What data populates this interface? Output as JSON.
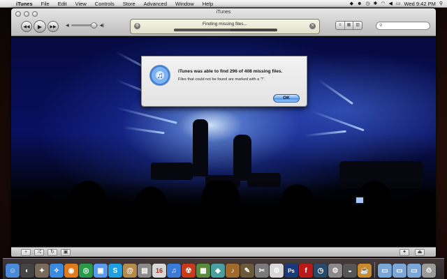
{
  "menubar": {
    "app_name": "iTunes",
    "items": [
      "File",
      "Edit",
      "View",
      "Controls",
      "Store",
      "Advanced",
      "Window",
      "Help"
    ],
    "clock": "Wed 9:42 PM"
  },
  "window": {
    "title": "iTunes",
    "lcd_status": "Finding missing files...",
    "progress_fraction": 0.55,
    "search_placeholder": ""
  },
  "dialog": {
    "title": "iTunes was able to find 296 of 408 missing files.",
    "message": "Files that could not be found are marked with a \"!\".",
    "ok_label": "OK"
  },
  "calendar": {
    "day": "16"
  },
  "accent_colors": {
    "ok_button": "#4c92e6",
    "lcd": "#e8ead4"
  },
  "dock": {
    "icons": [
      {
        "name": "finder-icon",
        "color": "#4a8ad8",
        "glyph": "☺"
      },
      {
        "name": "dashboard-icon",
        "color": "#444",
        "glyph": "◐"
      },
      {
        "name": "system-utility-icon",
        "color": "#7a6a5a",
        "glyph": "✦"
      },
      {
        "name": "safari-icon",
        "color": "#3a8ae0",
        "glyph": "✧"
      },
      {
        "name": "firefox-icon",
        "color": "#e07a1a",
        "glyph": "◉"
      },
      {
        "name": "chrome-icon",
        "color": "#2a9a4a",
        "glyph": "◎"
      },
      {
        "name": "facetime-icon",
        "color": "#5a9aee",
        "glyph": "▣"
      },
      {
        "name": "skype-icon",
        "color": "#1ea0e0",
        "glyph": "S"
      },
      {
        "name": "address-book-icon",
        "color": "#b58a4a",
        "glyph": "@"
      },
      {
        "name": "preview-icon",
        "color": "#8a8a8a",
        "glyph": "▤"
      },
      {
        "name": "calendar-icon",
        "color": "#d8d8d8",
        "glyph": "16"
      },
      {
        "name": "itunes-icon",
        "color": "#3a7ad8",
        "glyph": "♫"
      },
      {
        "name": "burn-icon",
        "color": "#c83a1a",
        "glyph": "☢"
      },
      {
        "name": "app-store-icon",
        "color": "#5a8a3a",
        "glyph": "▦"
      },
      {
        "name": "archive-icon",
        "color": "#4aa0a0",
        "glyph": "◆"
      },
      {
        "name": "guitar-icon",
        "color": "#a06a2a",
        "glyph": "♪"
      },
      {
        "name": "photo-icon",
        "color": "#6a5a3a",
        "glyph": "✎"
      },
      {
        "name": "tools-icon",
        "color": "#7a7a7a",
        "glyph": "✂"
      },
      {
        "name": "script-icon",
        "color": "#d8d8d8",
        "glyph": "⚙"
      },
      {
        "name": "photoshop-icon",
        "color": "#1a3a7a",
        "glyph": "Ps"
      },
      {
        "name": "flash-icon",
        "color": "#b81a1a",
        "glyph": "f"
      },
      {
        "name": "time-machine-icon",
        "color": "#2a4a6a",
        "glyph": "◷"
      },
      {
        "name": "system-preferences-icon",
        "color": "#8a8a8a",
        "glyph": "⚙"
      },
      {
        "name": "disk-utility-icon",
        "color": "#555",
        "glyph": "◒"
      },
      {
        "name": "terminal-icon",
        "color": "#c88a2a",
        "glyph": "☕"
      }
    ],
    "right_icons": [
      {
        "name": "applications-folder-icon",
        "color": "#7aa6d8",
        "glyph": "▭"
      },
      {
        "name": "documents-folder-icon",
        "color": "#7aa6d8",
        "glyph": "▭"
      },
      {
        "name": "downloads-folder-icon",
        "color": "#7aa6d8",
        "glyph": "▭"
      },
      {
        "name": "trash-icon",
        "color": "#9a9a9a",
        "glyph": "♲"
      }
    ]
  }
}
